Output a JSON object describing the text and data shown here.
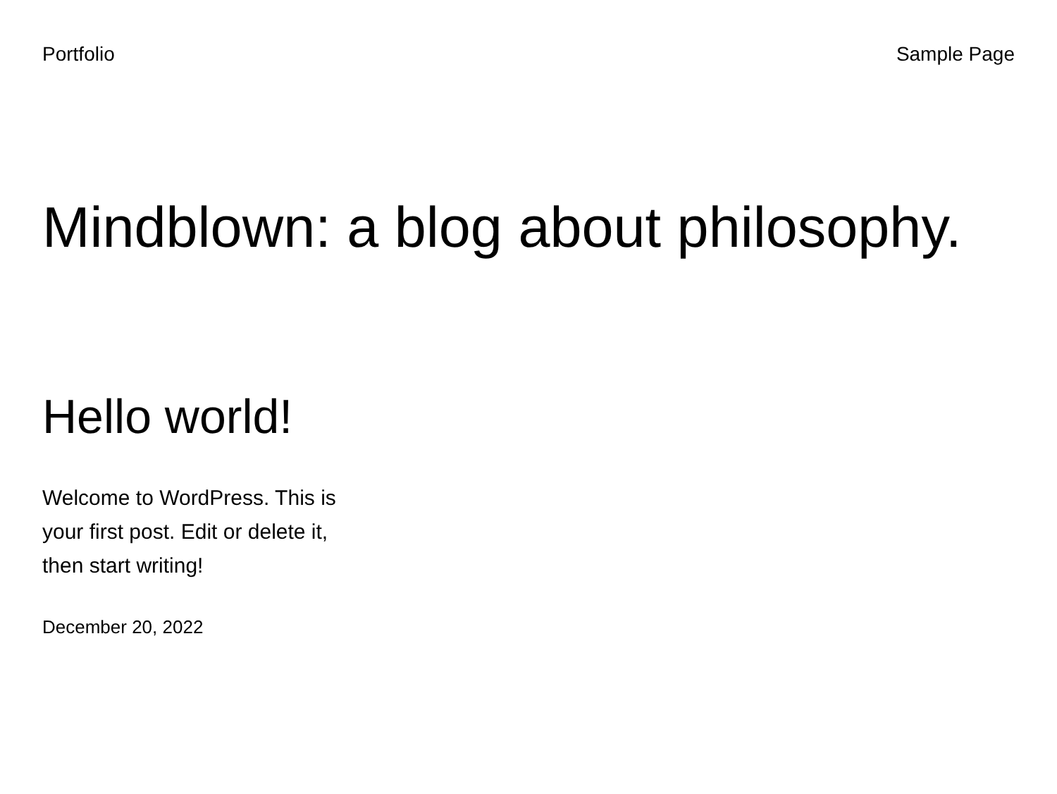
{
  "header": {
    "site_title": "Portfolio",
    "nav": [
      "Sample Page"
    ]
  },
  "tagline": "Mindblown: a blog about philosophy.",
  "posts": [
    {
      "title": "Hello world!",
      "excerpt": "Welcome to WordPress. This is your first post. Edit or delete it, then start writing!",
      "date": "December 20, 2022"
    }
  ]
}
